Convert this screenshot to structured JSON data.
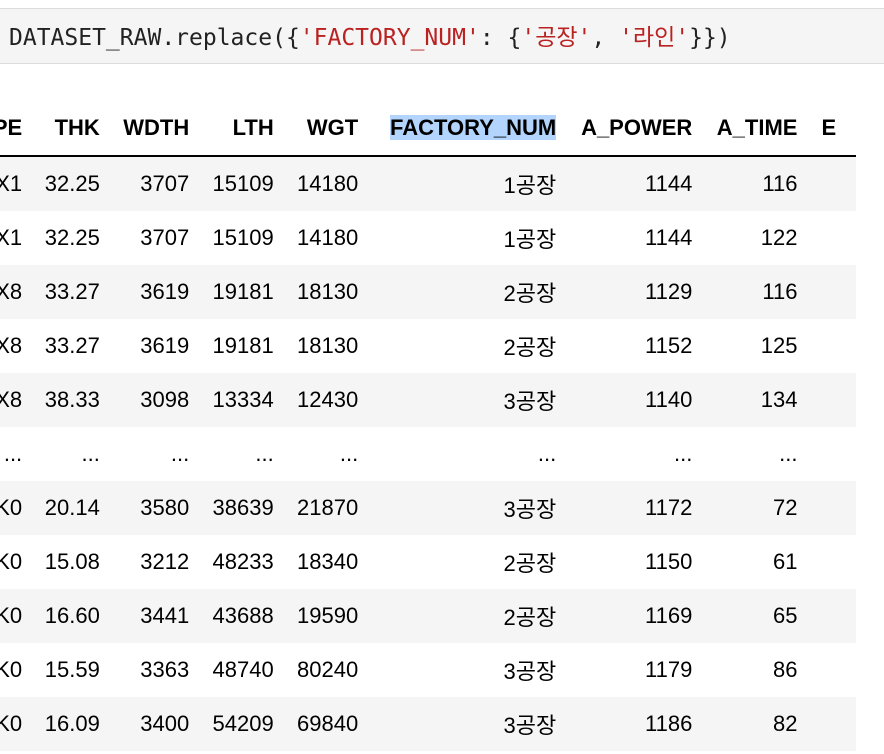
{
  "code": {
    "prefix": "DATASET_RAW.replace({",
    "key": "'FACTORY_NUM'",
    "sep1": ": {",
    "val1": "'공장'",
    "sep2": ", ",
    "val2": "'라인'",
    "suffix": "}})"
  },
  "table": {
    "columns": [
      "PE",
      "THK",
      "WDTH",
      "LTH",
      "WGT",
      "FACTORY_NUM",
      "A_POWER",
      "A_TIME",
      "E"
    ],
    "rows": [
      [
        "X1",
        "32.25",
        "3707",
        "15109",
        "14180",
        "1공장",
        "1144",
        "116"
      ],
      [
        "X1",
        "32.25",
        "3707",
        "15109",
        "14180",
        "1공장",
        "1144",
        "122"
      ],
      [
        "X8",
        "33.27",
        "3619",
        "19181",
        "18130",
        "2공장",
        "1129",
        "116"
      ],
      [
        "X8",
        "33.27",
        "3619",
        "19181",
        "18130",
        "2공장",
        "1152",
        "125"
      ],
      [
        "X8",
        "38.33",
        "3098",
        "13334",
        "12430",
        "3공장",
        "1140",
        "134"
      ],
      [
        "...",
        "...",
        "...",
        "...",
        "...",
        "...",
        "...",
        "..."
      ],
      [
        "K0",
        "20.14",
        "3580",
        "38639",
        "21870",
        "3공장",
        "1172",
        "72"
      ],
      [
        "K0",
        "15.08",
        "3212",
        "48233",
        "18340",
        "2공장",
        "1150",
        "61"
      ],
      [
        "K0",
        "16.60",
        "3441",
        "43688",
        "19590",
        "2공장",
        "1169",
        "65"
      ],
      [
        "K0",
        "15.59",
        "3363",
        "48740",
        "80240",
        "3공장",
        "1179",
        "86"
      ],
      [
        "K0",
        "16.09",
        "3400",
        "54209",
        "69840",
        "3공장",
        "1186",
        "82"
      ]
    ]
  },
  "colors": {
    "string_literal": "#ba2121",
    "highlight": "#b3d4fc",
    "row_stripe": "#f5f5f5"
  }
}
